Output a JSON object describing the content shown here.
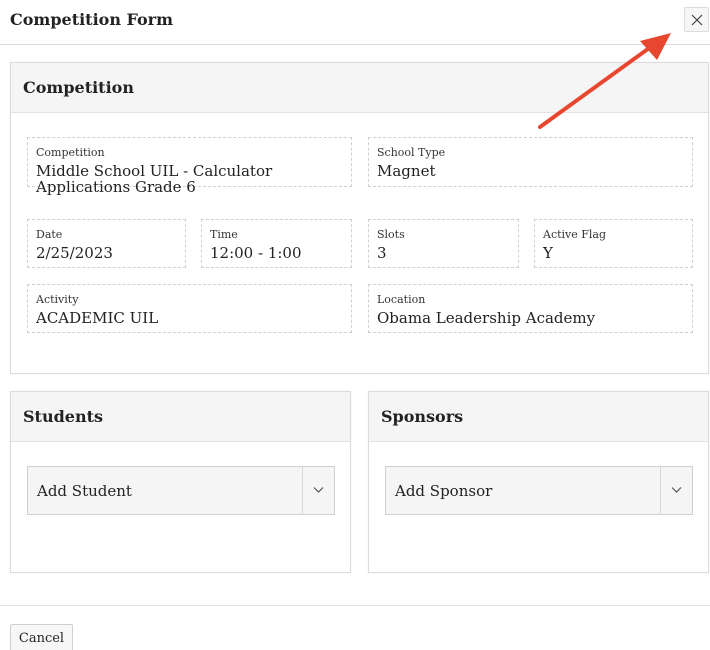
{
  "modal": {
    "title": "Competition Form",
    "close_icon": "close-icon"
  },
  "competition_panel": {
    "title": "Competition",
    "fields": {
      "competition": {
        "label": "Competition",
        "value": "Middle School UIL - Calculator Applications Grade 6"
      },
      "school_type": {
        "label": "School Type",
        "value": "Magnet"
      },
      "date": {
        "label": "Date",
        "value": "2/25/2023"
      },
      "time": {
        "label": "Time",
        "value": "12:00 - 1:00"
      },
      "slots": {
        "label": "Slots",
        "value": "3"
      },
      "active_flag": {
        "label": "Active Flag",
        "value": "Y"
      },
      "activity": {
        "label": "Activity",
        "value": "ACADEMIC UIL"
      },
      "location": {
        "label": "Location",
        "value": "Obama Leadership Academy"
      }
    }
  },
  "students_panel": {
    "title": "Students",
    "select_value": "Add Student",
    "select_icon": "chevron-down-icon"
  },
  "sponsors_panel": {
    "title": "Sponsors",
    "select_value": "Add Sponsor",
    "select_icon": "chevron-down-icon"
  },
  "footer": {
    "cancel_label": "Cancel"
  },
  "annotation": {
    "arrow_color": "#e8472f",
    "points_to": "close-button"
  }
}
